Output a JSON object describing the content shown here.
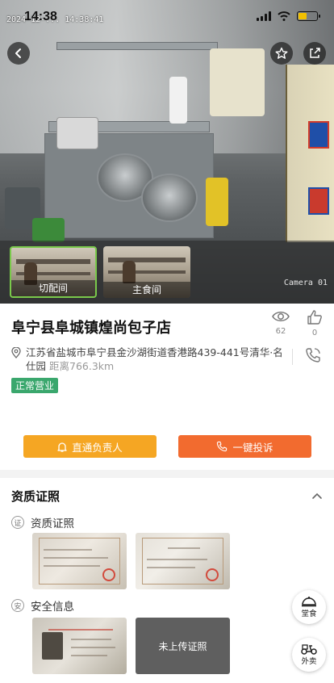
{
  "status_bar": {
    "time": "14:38"
  },
  "camera": {
    "timestamp": "2024-12-... 14:38:41",
    "watermark": "Camera 01",
    "views": [
      {
        "label": "切配间",
        "active": true
      },
      {
        "label": "主食间",
        "active": false
      }
    ]
  },
  "store": {
    "name": "阜宁县阜城镇煌尚包子店",
    "views": "62",
    "likes": "0",
    "address": "江苏省盐城市阜宁县金沙湖街道香港路439-441号清华·名仕园",
    "distance": "距离766.3km",
    "status_badge": "正常营业",
    "contact_button": "直通负责人",
    "complain_button": "一键投诉"
  },
  "qualification": {
    "title": "资质证照",
    "sections": [
      {
        "icon_char": "证",
        "title": "资质证照"
      },
      {
        "icon_char": "安",
        "title": "安全信息",
        "empty_label": "未上传证照"
      }
    ]
  },
  "floating": {
    "dine_in": "堂食",
    "takeout": "外卖"
  },
  "colors": {
    "badge": "#3aa76d",
    "contact": "#f5a623",
    "complain": "#f26b2f"
  }
}
